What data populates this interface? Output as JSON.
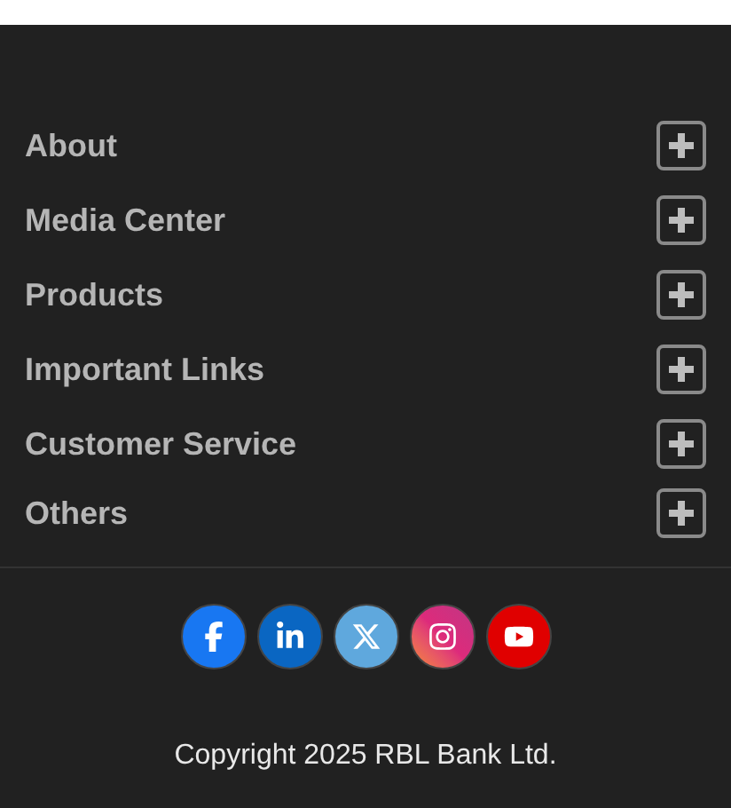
{
  "sections": [
    {
      "label": "About",
      "expanded": false
    },
    {
      "label": "Media Center",
      "expanded": false
    },
    {
      "label": "Products",
      "expanded": false
    },
    {
      "label": "Important Links",
      "expanded": false
    },
    {
      "label": "Customer Service",
      "expanded": false
    },
    {
      "label": "Others",
      "expanded": false
    }
  ],
  "social_links": [
    {
      "kind": "facebook"
    },
    {
      "kind": "linkedin"
    },
    {
      "kind": "x"
    },
    {
      "kind": "instagram"
    },
    {
      "kind": "youtube"
    }
  ],
  "copyright": "Copyright 2025 RBL Bank Ltd."
}
